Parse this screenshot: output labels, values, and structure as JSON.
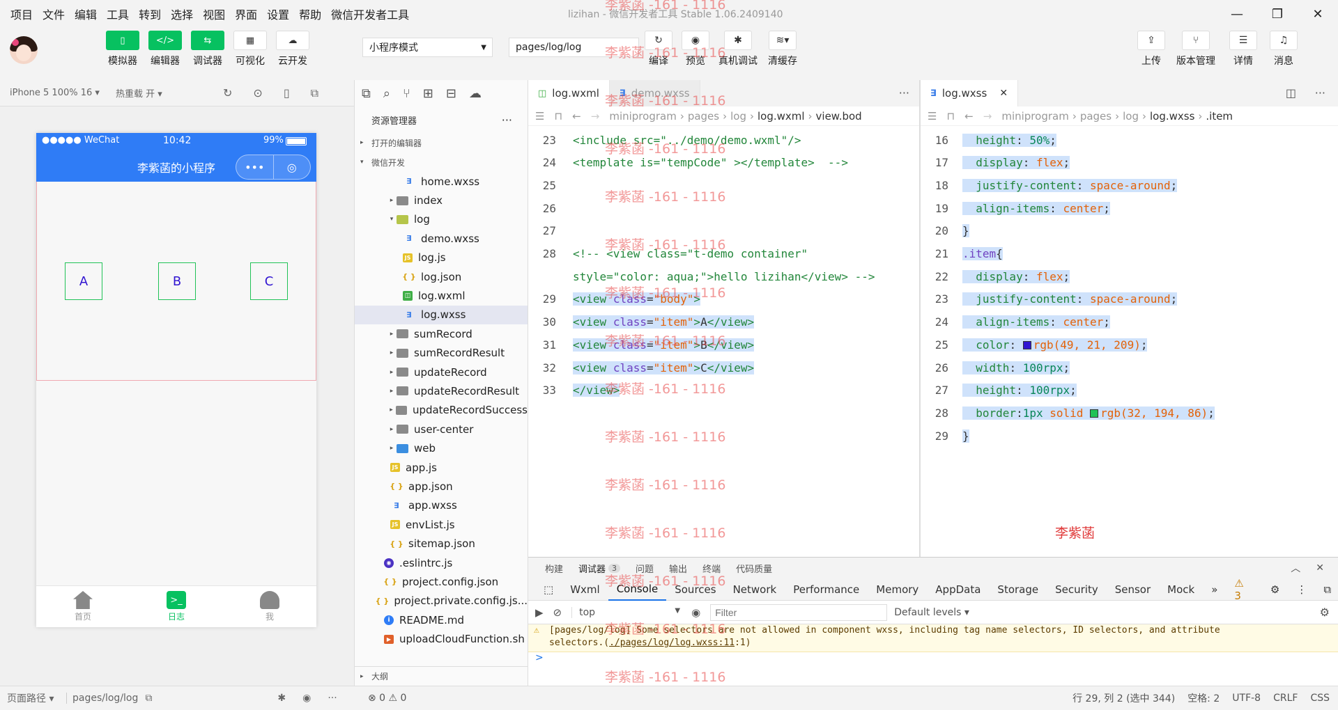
{
  "menu": [
    "项目",
    "文件",
    "编辑",
    "工具",
    "转到",
    "选择",
    "视图",
    "界面",
    "设置",
    "帮助",
    "微信开发者工具"
  ],
  "window_title": "lizihan - 微信开发者工具 Stable 1.06.2409140",
  "window_controls": [
    "—",
    "❐",
    "✕"
  ],
  "toolbar": {
    "left_buttons": [
      {
        "label": "模拟器",
        "icon": "phone-icon"
      },
      {
        "label": "编辑器",
        "icon": "code-icon"
      },
      {
        "label": "调试器",
        "icon": "debug-icon"
      },
      {
        "label": "可视化",
        "icon": "layout-icon"
      },
      {
        "label": "云开发",
        "icon": "cloud-icon"
      }
    ],
    "mode_select": "小程序模式",
    "page_select": "pages/log/log",
    "mid_buttons": [
      {
        "label": "编译",
        "icon": "refresh-icon"
      },
      {
        "label": "预览",
        "icon": "eye-icon"
      },
      {
        "label": "真机调试",
        "icon": "bug-icon"
      },
      {
        "label": "清缓存",
        "icon": "layers-icon"
      }
    ],
    "right_buttons": [
      {
        "label": "上传",
        "icon": "upload-icon"
      },
      {
        "label": "版本管理",
        "icon": "branch-icon"
      },
      {
        "label": "详情",
        "icon": "menu-icon"
      },
      {
        "label": "消息",
        "icon": "bell-icon"
      }
    ]
  },
  "simulator": {
    "device": "iPhone 5 100% 16 ▾",
    "hot_reload": "热重载 开 ▾",
    "status_left": "●●●●● WeChat",
    "status_time": "10:42",
    "status_battery": "99%",
    "nav_title": "李紫菡的小程序",
    "items": [
      "A",
      "B",
      "C"
    ],
    "tabbar": [
      {
        "label": "首页",
        "icon": "home-icon",
        "active": false
      },
      {
        "label": "日志",
        "icon": "terminal-icon",
        "active": true
      },
      {
        "label": "我",
        "icon": "user-icon",
        "active": false
      }
    ],
    "footer_path_label": "页面路径 ▾",
    "footer_path": "pages/log/log"
  },
  "explorer": {
    "title": "资源管理器",
    "section_open": "打开的编辑器",
    "section_project": "微信开发",
    "outline": "大纲",
    "files": [
      {
        "name": "home.wxss",
        "type": "wxss",
        "indent": 3,
        "arrow": ""
      },
      {
        "name": "index",
        "type": "folder",
        "indent": 2,
        "arrow": "▸"
      },
      {
        "name": "log",
        "type": "folder-g",
        "indent": 2,
        "arrow": "▾"
      },
      {
        "name": "demo.wxss",
        "type": "wxss",
        "indent": 3,
        "arrow": ""
      },
      {
        "name": "log.js",
        "type": "js",
        "indent": 3,
        "arrow": ""
      },
      {
        "name": "log.json",
        "type": "json",
        "indent": 3,
        "arrow": ""
      },
      {
        "name": "log.wxml",
        "type": "wxml",
        "indent": 3,
        "arrow": ""
      },
      {
        "name": "log.wxss",
        "type": "wxss",
        "indent": 3,
        "arrow": "",
        "selected": true
      },
      {
        "name": "sumRecord",
        "type": "folder",
        "indent": 2,
        "arrow": "▸"
      },
      {
        "name": "sumRecordResult",
        "type": "folder",
        "indent": 2,
        "arrow": "▸"
      },
      {
        "name": "updateRecord",
        "type": "folder",
        "indent": 2,
        "arrow": "▸"
      },
      {
        "name": "updateRecordResult",
        "type": "folder",
        "indent": 2,
        "arrow": "▸"
      },
      {
        "name": "updateRecordSuccess",
        "type": "folder",
        "indent": 2,
        "arrow": "▸"
      },
      {
        "name": "user-center",
        "type": "folder",
        "indent": 2,
        "arrow": "▸"
      },
      {
        "name": "web",
        "type": "folder-b",
        "indent": 2,
        "arrow": "▸"
      },
      {
        "name": "app.js",
        "type": "js",
        "indent": 1,
        "arrow": ""
      },
      {
        "name": "app.json",
        "type": "json",
        "indent": 1,
        "arrow": ""
      },
      {
        "name": "app.wxss",
        "type": "wxss",
        "indent": 1,
        "arrow": ""
      },
      {
        "name": "envList.js",
        "type": "js",
        "indent": 1,
        "arrow": ""
      },
      {
        "name": "sitemap.json",
        "type": "json",
        "indent": 1,
        "arrow": ""
      },
      {
        "name": ".eslintrc.js",
        "type": "eslint",
        "indent": 0,
        "arrow": ""
      },
      {
        "name": "project.config.json",
        "type": "json",
        "indent": 0,
        "arrow": ""
      },
      {
        "name": "project.private.config.js...",
        "type": "json",
        "indent": 0,
        "arrow": ""
      },
      {
        "name": "README.md",
        "type": "md",
        "indent": 0,
        "arrow": ""
      },
      {
        "name": "uploadCloudFunction.sh",
        "type": "sh",
        "indent": 0,
        "arrow": ""
      }
    ]
  },
  "editor_left": {
    "tab_active": "log.wxml",
    "tab_inactive": "demo.wxss",
    "breadcrumb": [
      "miniprogram",
      "pages",
      "log",
      "log.wxml",
      "view.bod"
    ],
    "lines": [
      {
        "n": "23",
        "html": "<span class=\"t-cmt\">&lt;include src=\"../demo/demo.wxml\"/&gt;</span>"
      },
      {
        "n": "24",
        "html": "<span class=\"t-cmt\">&lt;template is=\"tempCode\" &gt;&lt;/template&gt;  --&gt;</span>"
      },
      {
        "n": "25",
        "html": ""
      },
      {
        "n": "26",
        "html": ""
      },
      {
        "n": "27",
        "html": ""
      },
      {
        "n": "28",
        "html": "<span class=\"t-cmt\">&lt;!-- &lt;view class=\"t-demo container\"</span>"
      },
      {
        "n": "",
        "html": "<span class=\"t-cmt\">style=\"color: aqua;\"&gt;hello lizihan&lt;/view&gt; --&gt;</span>"
      },
      {
        "n": "29",
        "html": "<span class=\"hl\"><span class=\"t-tag\">&lt;view</span> <span class=\"t-attr\">class</span>=<span class=\"t-str\">\"body\"</span><span class=\"t-tag\">&gt;</span></span>"
      },
      {
        "n": "30",
        "html": "<span class=\"hl\"><span class=\"t-tag\">&lt;view</span> <span class=\"t-attr\">class</span>=<span class=\"t-str\">\"item\"</span><span class=\"t-tag\">&gt;</span>A<span class=\"t-tag\">&lt;/view&gt;</span></span>"
      },
      {
        "n": "31",
        "html": "<span class=\"hl\"><span class=\"t-tag\">&lt;view</span> <span class=\"t-attr\">class</span>=<span class=\"t-str\">\"item\"</span><span class=\"t-tag\">&gt;</span>B<span class=\"t-tag\">&lt;/view&gt;</span></span>"
      },
      {
        "n": "32",
        "html": "<span class=\"hl\"><span class=\"t-tag\">&lt;view</span> <span class=\"t-attr\">class</span>=<span class=\"t-str\">\"item\"</span><span class=\"t-tag\">&gt;</span>C<span class=\"t-tag\">&lt;/view&gt;</span></span>"
      },
      {
        "n": "33",
        "html": "<span class=\"hl\"><span class=\"t-tag\">&lt;/view&gt;</span></span>"
      }
    ]
  },
  "editor_right": {
    "tab_active": "log.wxss",
    "breadcrumb": [
      "miniprogram",
      "pages",
      "log",
      "log.wxss",
      ".item"
    ],
    "lines": [
      {
        "n": "16",
        "html": "<span class=\"hl\">  <span class=\"t-prop\">height</span>: <span class=\"t-num\">50%</span>;</span>"
      },
      {
        "n": "17",
        "html": "<span class=\"hl\">  <span class=\"t-prop\">display</span>: <span class=\"t-val\">flex</span>;</span>"
      },
      {
        "n": "18",
        "html": "<span class=\"hl\">  <span class=\"t-prop\">justify-content</span>: <span class=\"t-val\">space-around</span>;</span>"
      },
      {
        "n": "19",
        "html": "<span class=\"hl\">  <span class=\"t-prop\">align-items</span>: <span class=\"t-val\">center</span>;</span>"
      },
      {
        "n": "20",
        "html": "<span class=\"hl\">}</span>"
      },
      {
        "n": "21",
        "html": "<span class=\"hl\"><span class=\"t-sel\">.item</span>{</span>"
      },
      {
        "n": "22",
        "html": "<span class=\"hl\">  <span class=\"t-prop\">display</span>: <span class=\"t-val\">flex</span>;</span>"
      },
      {
        "n": "23",
        "html": "<span class=\"hl\">  <span class=\"t-prop\">justify-content</span>: <span class=\"t-val\">space-around</span>;</span>"
      },
      {
        "n": "24",
        "html": "<span class=\"hl\">  <span class=\"t-prop\">align-items</span>: <span class=\"t-val\">center</span>;</span>"
      },
      {
        "n": "25",
        "html": "<span class=\"hl\">  <span class=\"t-prop\">color</span>: <span class=\"swatch\" style=\"background:#3115d1\"></span><span class=\"t-val\">rgb(49, 21, 209)</span>;</span>"
      },
      {
        "n": "26",
        "html": "<span class=\"hl\">  <span class=\"t-prop\">width</span>: <span class=\"t-num\">100rpx</span>;</span>"
      },
      {
        "n": "27",
        "html": "<span class=\"hl\">  <span class=\"t-prop\">height</span>: <span class=\"t-num\">100rpx</span>;</span>"
      },
      {
        "n": "28",
        "html": "<span class=\"hl\">  <span class=\"t-prop\">border</span>:<span class=\"t-num\">1px</span> <span class=\"t-val\">solid</span> <span class=\"swatch\" style=\"background:#20c256\"></span><span class=\"t-val\">rgb(32, 194, 86)</span>;</span>"
      },
      {
        "n": "29",
        "html": "<span class=\"hl\">}</span>"
      }
    ]
  },
  "watermark": "李紫菡 -161 - 1116",
  "watermark_short": "李紫菡",
  "devtools": {
    "top_tabs": [
      "构建",
      "调试器",
      "问题",
      "输出",
      "终端",
      "代码质量"
    ],
    "badge": "3",
    "tabs": [
      "Wxml",
      "Console",
      "Sources",
      "Network",
      "Performance",
      "Memory",
      "AppData",
      "Storage",
      "Security",
      "Sensor",
      "Mock"
    ],
    "more": "»",
    "warn_count": "⚠ 3",
    "context": "top",
    "filter_placeholder": "Filter",
    "levels": "Default levels ▾",
    "warning_line1": "[pages/log/log] Some selectors are not allowed in component wxss, including tag name selectors, ID selectors, and attribute",
    "warning_line2a": "selectors.(",
    "warning_link": "./pages/log/log.wxss:11",
    "warning_line2b": ":1)",
    "prompt": ">"
  },
  "statusbar": {
    "problems": "⊗ 0 ⚠ 0",
    "position": "行 29, 列 2 (选中 344)",
    "spaces": "空格: 2",
    "encoding": "UTF-8",
    "eol": "CRLF",
    "lang": "CSS"
  }
}
